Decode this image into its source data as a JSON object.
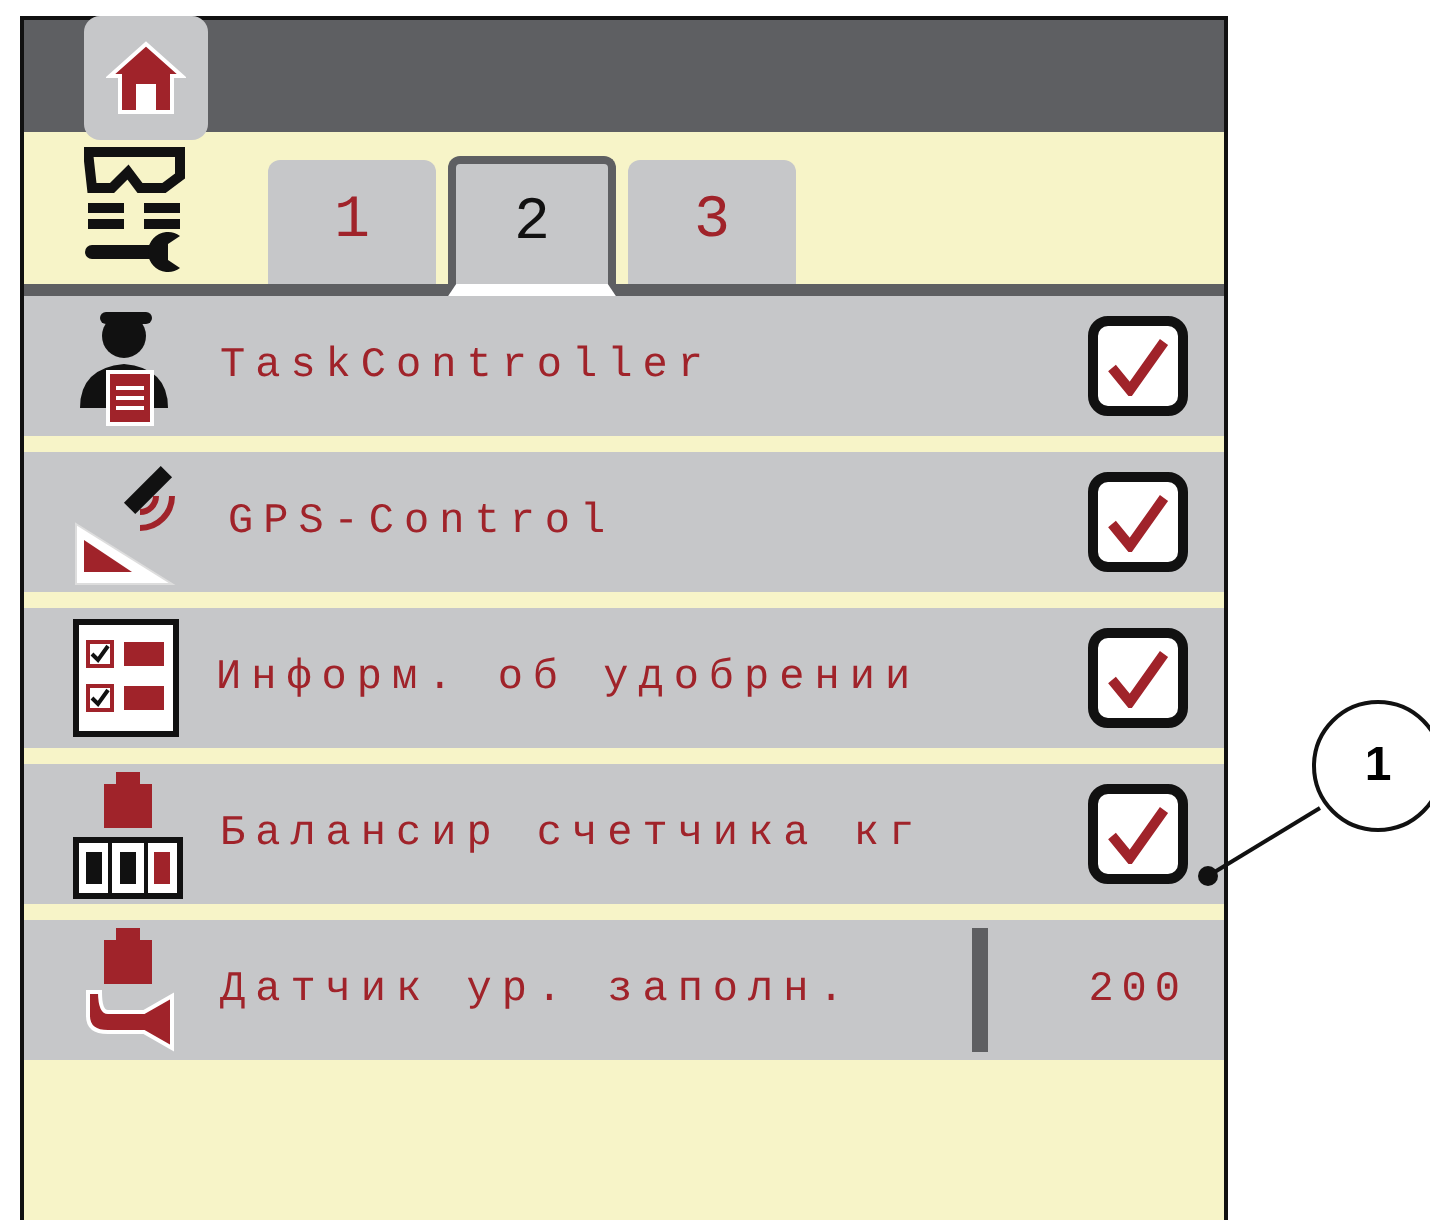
{
  "tabs": [
    {
      "label": "1",
      "selected": false
    },
    {
      "label": "2",
      "selected": true
    },
    {
      "label": "3",
      "selected": false
    }
  ],
  "rows": [
    {
      "kind": "checkbox",
      "label": "TaskController",
      "checked": true
    },
    {
      "kind": "checkbox",
      "label": "GPS-Control",
      "checked": true
    },
    {
      "kind": "checkbox",
      "label": "Информ. об удобрении",
      "checked": true
    },
    {
      "kind": "checkbox",
      "label": "Балансир счетчика кг",
      "checked": true
    },
    {
      "kind": "value",
      "label": "Датчик ур. заполн.",
      "value": "200"
    }
  ],
  "callout": {
    "label": "1"
  }
}
